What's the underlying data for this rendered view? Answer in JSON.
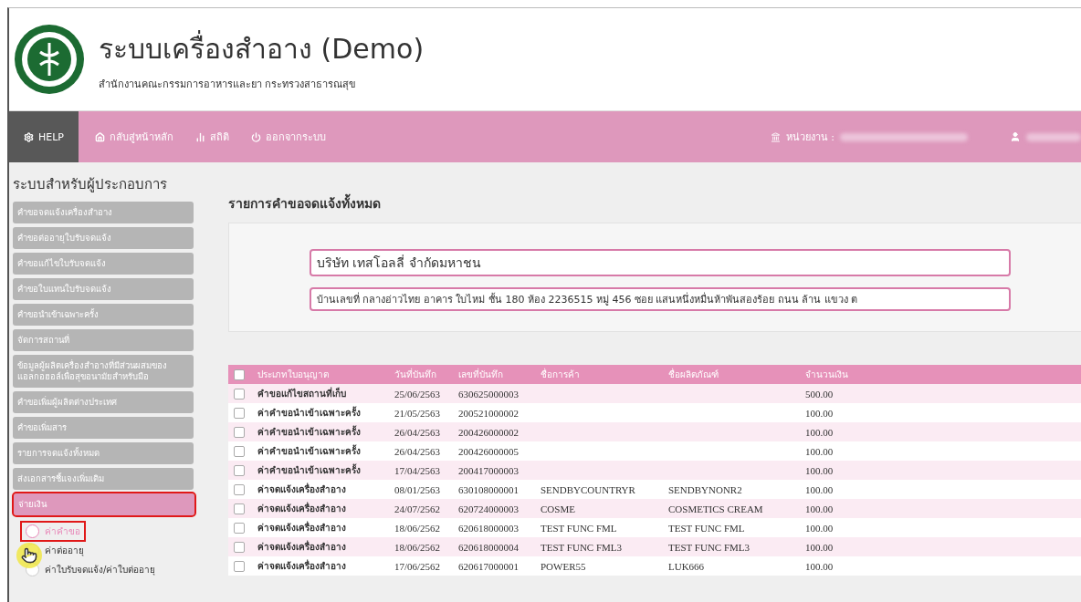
{
  "header": {
    "title": "ระบบเครื่องสำอาง (Demo)",
    "subtitle": "สำนักงานคณะกรรมการอาหารและยา กระทรวงสาธารณสุข"
  },
  "nav": {
    "items": [
      {
        "label": "HELP",
        "selected": true
      },
      {
        "label": "กลับสู่หน้าหลัก",
        "selected": false
      },
      {
        "label": "สถิติ",
        "selected": false
      },
      {
        "label": "ออกจากระบบ",
        "selected": false
      }
    ],
    "agency_label": "หน่วยงาน :"
  },
  "sidebar": {
    "title": "ระบบสำหรับผู้ประกอบการ",
    "items": [
      {
        "label": "คำขอจดแจ้งเครื่องสำอาง",
        "selected": false
      },
      {
        "label": "คำขอต่ออายุใบรับจดแจ้ง",
        "selected": false
      },
      {
        "label": "คำขอแก้ไขใบรับจดแจ้ง",
        "selected": false
      },
      {
        "label": "คำขอใบแทนใบรับจดแจ้ง",
        "selected": false
      },
      {
        "label": "คำขอนำเข้าเฉพาะครั้ง",
        "selected": false
      },
      {
        "label": "จัดการสถานที่",
        "selected": false
      },
      {
        "label": "ข้อมูลผู้ผลิตเครื่องสำอางที่มีส่วนผสมของแอลกอฮอล์เพื่อสุขอนามัยสำหรับมือ",
        "selected": false
      },
      {
        "label": "คำขอเพิ่มผู้ผลิตต่างประเทศ",
        "selected": false
      },
      {
        "label": "คำขอเพิ่มสาร",
        "selected": false
      },
      {
        "label": "รายการจดแจ้งทั้งหมด",
        "selected": false
      },
      {
        "label": "ส่งเอกสารชี้แจงเพิ่มเติม",
        "selected": false
      },
      {
        "label": "จ่ายเงิน",
        "selected": true,
        "children": [
          {
            "label": "ค่าคำขอ",
            "selected": true
          },
          {
            "label": "ค่าต่ออายุ",
            "selected": false
          },
          {
            "label": "ค่าใบรับจดแจ้ง/ค่าใบต่ออายุ",
            "selected": false
          }
        ]
      }
    ]
  },
  "main": {
    "title": "รายการคำขอจดแจ้งทั้งหมด",
    "company": {
      "name": "บริษัท เทสโอลลี่ จำกัดมหาชน",
      "address": "บ้านเลขที่ กลางอ่าวไทย อาคาร ใบไหม่ ชั้น 180 ห้อง 2236515 หมู่ 456 ซอย แสนหนึ่งหมื่นห้าพันสองร้อย ถนน ล้าน แขวง ต"
    },
    "table": {
      "select_all_checked": false,
      "columns": [
        "ประเภทใบอนุญาต",
        "วันที่บันทึก",
        "เลขที่บันทึก",
        "ชื่อการค้า",
        "ชื่อผลิตภัณฑ์",
        "จำนวนเงิน"
      ],
      "rows": [
        {
          "checked": false,
          "cells": [
            "คำขอแก้ไขสถานที่เก็บ",
            "25/06/2563",
            "630625000003",
            "",
            "",
            "500.00"
          ]
        },
        {
          "checked": false,
          "cells": [
            "ค่าคำขอนำเข้าเฉพาะครั้ง",
            "21/05/2563",
            "200521000002",
            "",
            "",
            "100.00"
          ]
        },
        {
          "checked": false,
          "cells": [
            "ค่าคำขอนำเข้าเฉพาะครั้ง",
            "26/04/2563",
            "200426000002",
            "",
            "",
            "100.00"
          ]
        },
        {
          "checked": false,
          "cells": [
            "ค่าคำขอนำเข้าเฉพาะครั้ง",
            "26/04/2563",
            "200426000005",
            "",
            "",
            "100.00"
          ]
        },
        {
          "checked": false,
          "cells": [
            "ค่าคำขอนำเข้าเฉพาะครั้ง",
            "17/04/2563",
            "200417000003",
            "",
            "",
            "100.00"
          ]
        },
        {
          "checked": false,
          "cells": [
            "ค่าจดแจ้งเครื่องสำอาง",
            "08/01/2563",
            "630108000001",
            "SENDBYCOUNTRYR",
            "SENDBYNONR2",
            "100.00"
          ]
        },
        {
          "checked": false,
          "cells": [
            "ค่าจดแจ้งเครื่องสำอาง",
            "24/07/2562",
            "620724000003",
            "COSME",
            "COSMETICS CREAM",
            "100.00"
          ]
        },
        {
          "checked": false,
          "cells": [
            "ค่าจดแจ้งเครื่องสำอาง",
            "18/06/2562",
            "620618000003",
            "TEST FUNC FML",
            "TEST FUNC FML",
            "100.00"
          ]
        },
        {
          "checked": false,
          "cells": [
            "ค่าจดแจ้งเครื่องสำอาง",
            "18/06/2562",
            "620618000004",
            "TEST FUNC FML3",
            "TEST FUNC FML3",
            "100.00"
          ]
        },
        {
          "checked": false,
          "cells": [
            "ค่าจดแจ้งเครื่องสำอาง",
            "17/06/2562",
            "620617000001",
            "POWER55",
            "LUK666",
            "100.00"
          ]
        }
      ]
    }
  }
}
